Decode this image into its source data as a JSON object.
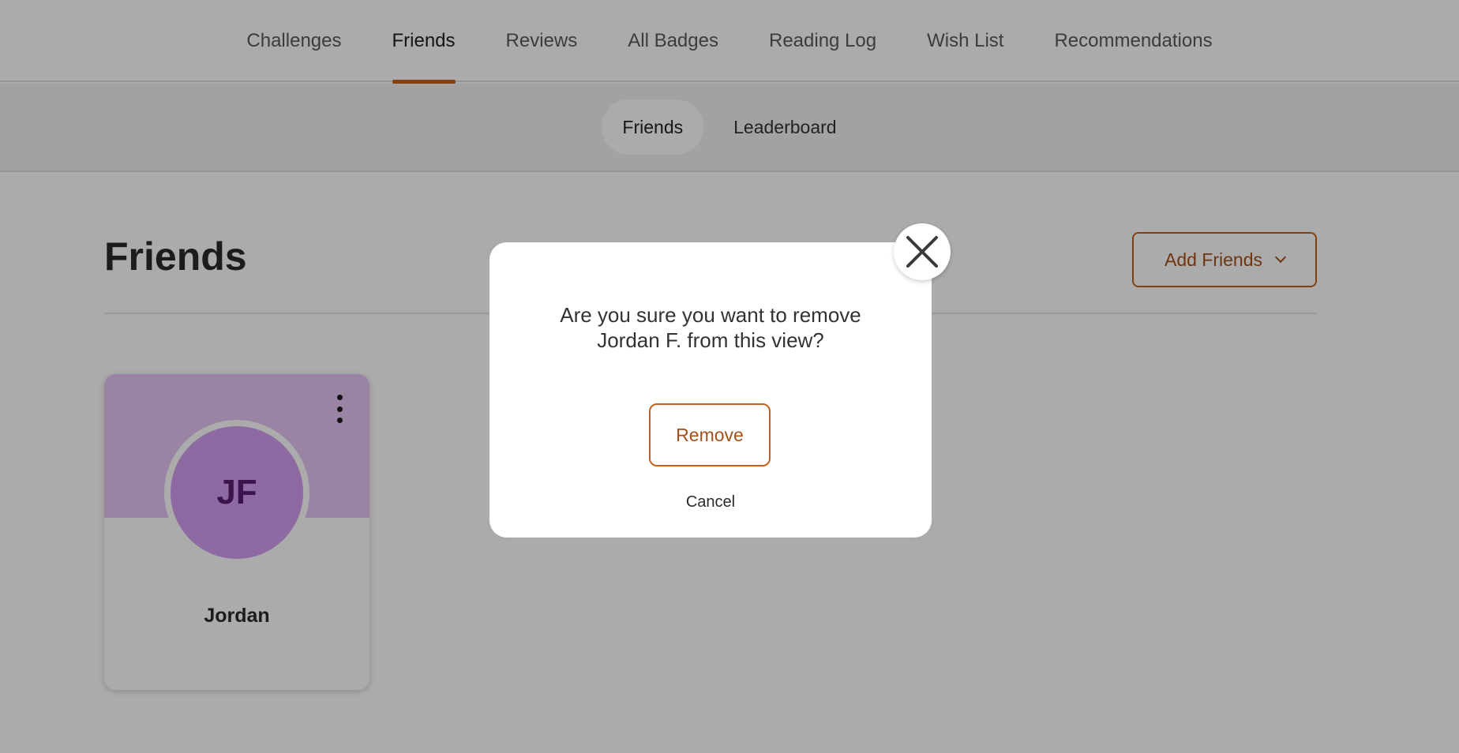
{
  "topnav": {
    "items": [
      {
        "label": "Challenges",
        "active": false
      },
      {
        "label": "Friends",
        "active": true
      },
      {
        "label": "Reviews",
        "active": false
      },
      {
        "label": "All Badges",
        "active": false
      },
      {
        "label": "Reading Log",
        "active": false
      },
      {
        "label": "Wish List",
        "active": false
      },
      {
        "label": "Recommendations",
        "active": false
      }
    ]
  },
  "subnav": {
    "items": [
      {
        "label": "Friends",
        "active": true
      },
      {
        "label": "Leaderboard",
        "active": false
      }
    ]
  },
  "main": {
    "title": "Friends",
    "add_friends_label": "Add Friends",
    "friends": [
      {
        "initials": "JF",
        "name": "Jordan"
      }
    ]
  },
  "modal": {
    "message_line1": "Are you sure you want to remove",
    "message_line2": "Jordan F. from this view?",
    "remove_label": "Remove",
    "cancel_label": "Cancel"
  },
  "colors": {
    "accent": "#c4621b",
    "accent_text": "#a5501a",
    "card_banner": "#e5c5f4",
    "avatar_bg": "#d39ff0",
    "avatar_text": "#5a1f70"
  },
  "icons": {
    "close": "close-icon",
    "menu": "kebab-menu-icon",
    "dropdown": "chevron-down-icon"
  }
}
